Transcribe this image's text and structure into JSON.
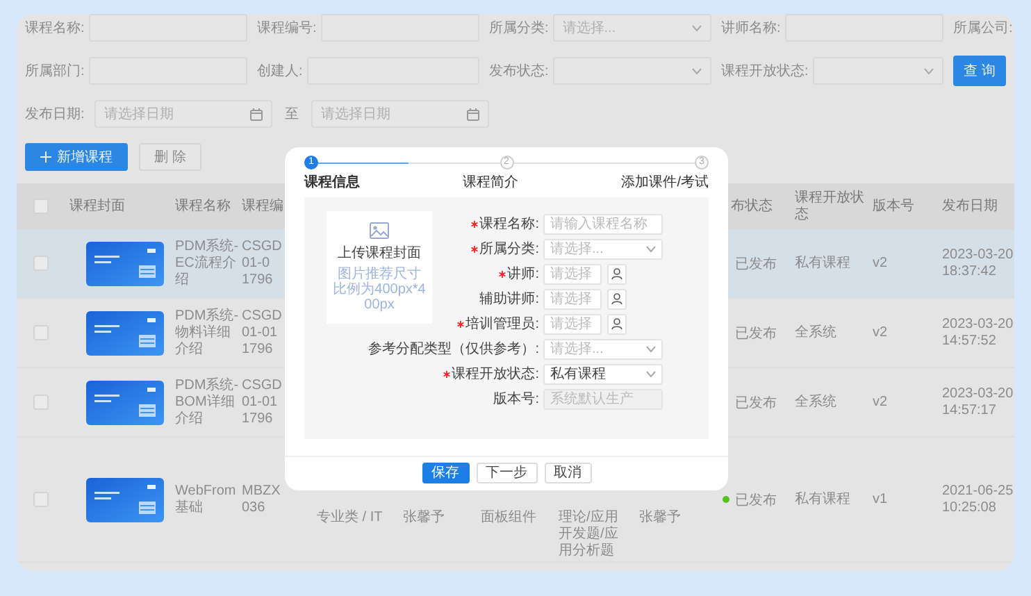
{
  "filters": [
    [
      {
        "kind": "input",
        "label": "课程名称:"
      },
      {
        "kind": "input",
        "label": "课程编号:"
      },
      {
        "kind": "select",
        "label": "所属分类:",
        "placeholder": "请选择..."
      },
      {
        "kind": "input",
        "label": "讲师名称:"
      },
      {
        "kind": "input",
        "label": "所属公司:"
      }
    ],
    [
      {
        "kind": "input",
        "label": "所属部门:"
      },
      {
        "kind": "input",
        "label": "创建人:"
      },
      {
        "kind": "select",
        "label": "发布状态:"
      },
      {
        "kind": "select",
        "label": "课程开放状态:"
      },
      {
        "kind": "button",
        "label": "查 询"
      }
    ],
    [
      {
        "kind": "date",
        "label": "发布日期:",
        "placeholder": "请选择日期"
      },
      {
        "kind": "separator",
        "label": "至"
      },
      {
        "kind": "date",
        "placeholder": "请选择日期"
      }
    ]
  ],
  "actions": [
    {
      "label": "新增课程",
      "primary": true
    },
    {
      "label": "删 除",
      "primary": false
    }
  ],
  "table": {
    "select_all": false,
    "header": {
      "cover": "课程封面",
      "name": "课程名称",
      "code": "课程编",
      "status": "布状态",
      "open_state": "课程开放状态",
      "version": "版本号",
      "date": "发布日期"
    },
    "rows": [
      {
        "hovered": true,
        "checked": false,
        "dot": false,
        "name": "PDM系统-EC流程介绍",
        "code": "CSGD\n01-0\n1796",
        "status": "已发布",
        "open_state": "私有课程",
        "version": "v2",
        "date": "2023-03-20 18:37:42"
      },
      {
        "hovered": false,
        "checked": false,
        "dot": false,
        "name": "PDM系统-物料详细介绍",
        "code": "CSGD\n01-01\n1796",
        "status": "已发布",
        "open_state": "全系统",
        "version": "v2",
        "date": "2023-03-20 14:57:52"
      },
      {
        "hovered": false,
        "checked": false,
        "dot": false,
        "name": "PDM系统-BOM详细介绍",
        "code": "CSGD\n01-01\n1796",
        "status": "已发布",
        "open_state": "全系统",
        "version": "v2",
        "date": "2023-03-20 14:57:17"
      },
      {
        "hovered": false,
        "checked": false,
        "dot": true,
        "name": "WebFrom基础",
        "code": "MBZX\n036",
        "category": "专业类 / IT",
        "creator": "张馨予",
        "column_7": "面板组件",
        "column_8": "理论/应用开发题/应用分析题",
        "column_9": "张馨予",
        "status": "已发布",
        "open_state": "私有课程",
        "version": "v1",
        "date": "2021-06-25 10:25:08"
      }
    ]
  },
  "dialog": {
    "steps": [
      {
        "number": "1",
        "label": "课程信息",
        "active": true
      },
      {
        "number": "2",
        "label": "课程简介",
        "active": false
      },
      {
        "number": "3",
        "label": "添加课件/考试",
        "active": false
      }
    ],
    "progress": {
      "level": 0.5
    },
    "upload": {
      "title": "上传课程封面",
      "hint": "图片推荐尺寸比例为400px*400px"
    },
    "form": [
      {
        "label": "课程名称:",
        "required": true,
        "kind": "input",
        "disabled": false,
        "placeholder": "请输入课程名称"
      },
      {
        "label": "所属分类:",
        "required": true,
        "kind": "select",
        "disabled": false,
        "placeholder": "请选择..."
      },
      {
        "label": "讲师:",
        "required": true,
        "kind": "picker",
        "disabled": false,
        "placeholder": "请选择"
      },
      {
        "label": "辅助讲师:",
        "required": false,
        "kind": "picker",
        "disabled": false,
        "placeholder": "请选择"
      },
      {
        "label": "培训管理员:",
        "required": true,
        "kind": "picker",
        "disabled": false,
        "placeholder": "请选择"
      },
      {
        "label": "参考分配类型（仅供参考）:",
        "required": false,
        "kind": "select",
        "disabled": false,
        "placeholder": "请选择..."
      },
      {
        "label": "课程开放状态:",
        "required": true,
        "kind": "select",
        "disabled": false,
        "value": "私有课程"
      },
      {
        "label": "版本号:",
        "required": false,
        "kind": "input",
        "disabled": true,
        "placeholder": "系统默认生产"
      }
    ],
    "buttons": [
      {
        "label": "保存",
        "primary": true
      },
      {
        "label": "下一步",
        "primary": false
      },
      {
        "label": "取消",
        "primary": false
      }
    ]
  }
}
